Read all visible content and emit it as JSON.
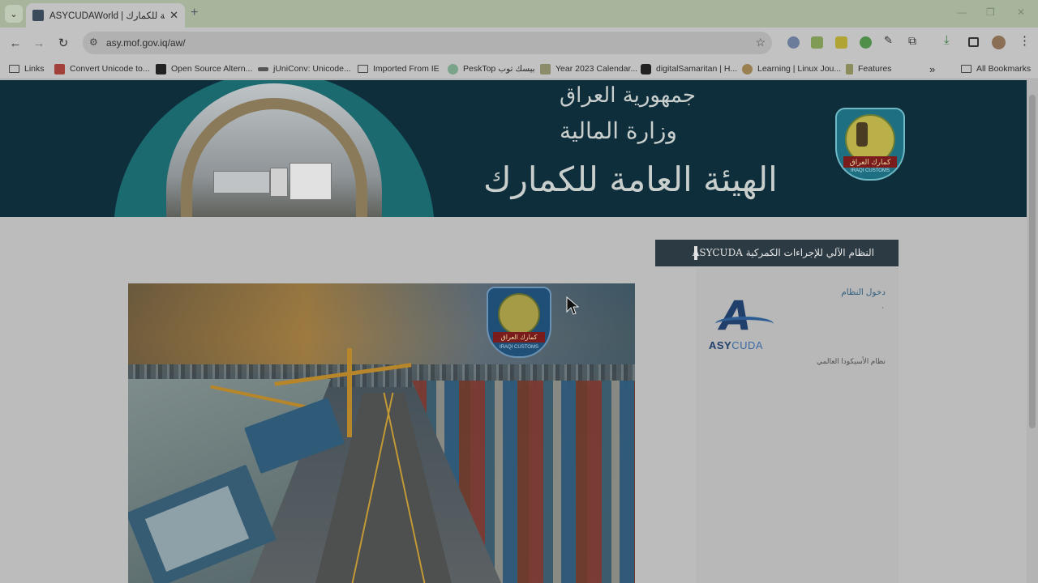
{
  "browser": {
    "tab_title": "ASYCUDAWorld | الهيئة العامة للكمارك",
    "tab_close": "✕",
    "new_tab": "+",
    "tab_list": "⌄",
    "url": "asy.mof.gov.iq/aw/",
    "back": "←",
    "forward": "→",
    "reload": "↻",
    "bookmark_star": "☆",
    "window_controls": {
      "minimize": "—",
      "maximize": "❐",
      "close": "✕"
    }
  },
  "bookmarks": {
    "items": [
      {
        "label": "Links",
        "icon": "folder-icon"
      },
      {
        "label": "Convert Unicode to...",
        "icon": "convert-unicode-icon"
      },
      {
        "label": "Open Source Altern...",
        "icon": "opensource-icon"
      },
      {
        "label": "jUniConv: Unicode...",
        "icon": "juniconv-icon"
      },
      {
        "label": "Imported From IE",
        "icon": "folder-icon"
      },
      {
        "label": "PeskTop بيسك توب",
        "icon": "pesktop-icon"
      },
      {
        "label": "Year 2023 Calendar...",
        "icon": "calendar-icon"
      },
      {
        "label": "digitalSamaritan | H...",
        "icon": "youtube-icon"
      },
      {
        "label": "Learning | Linux Jou...",
        "icon": "linux-icon"
      },
      {
        "label": "Features",
        "icon": "features-icon"
      }
    ],
    "more": "»",
    "all_bookmarks": "All Bookmarks"
  },
  "page": {
    "banner": {
      "line1": "جمهورية العراق",
      "line2": "وزارة المالية",
      "line3": "الهيئة العامة للكمارك",
      "emblem_label": "كمارك العراق",
      "emblem_sub": "IRAQI CUSTOMS"
    },
    "system_header": "النظام الآلي للإجراءات الكمركية ASYCUDA",
    "sidebar": {
      "login_link": "دخول النظام",
      "bullet": "،",
      "logo_text_a": "A",
      "logo_word_bold": "ASY",
      "logo_word_rest": "CUDA",
      "world_system": "نظام الأسيكودا العالمي"
    },
    "hero": {
      "badge_label": "كمارك العراق",
      "badge_sub": "IRAQI CUSTOMS"
    }
  },
  "colors": {
    "banner_bg": "#0f2e3c",
    "header_bg": "#2c3a43",
    "link": "#335f80"
  }
}
